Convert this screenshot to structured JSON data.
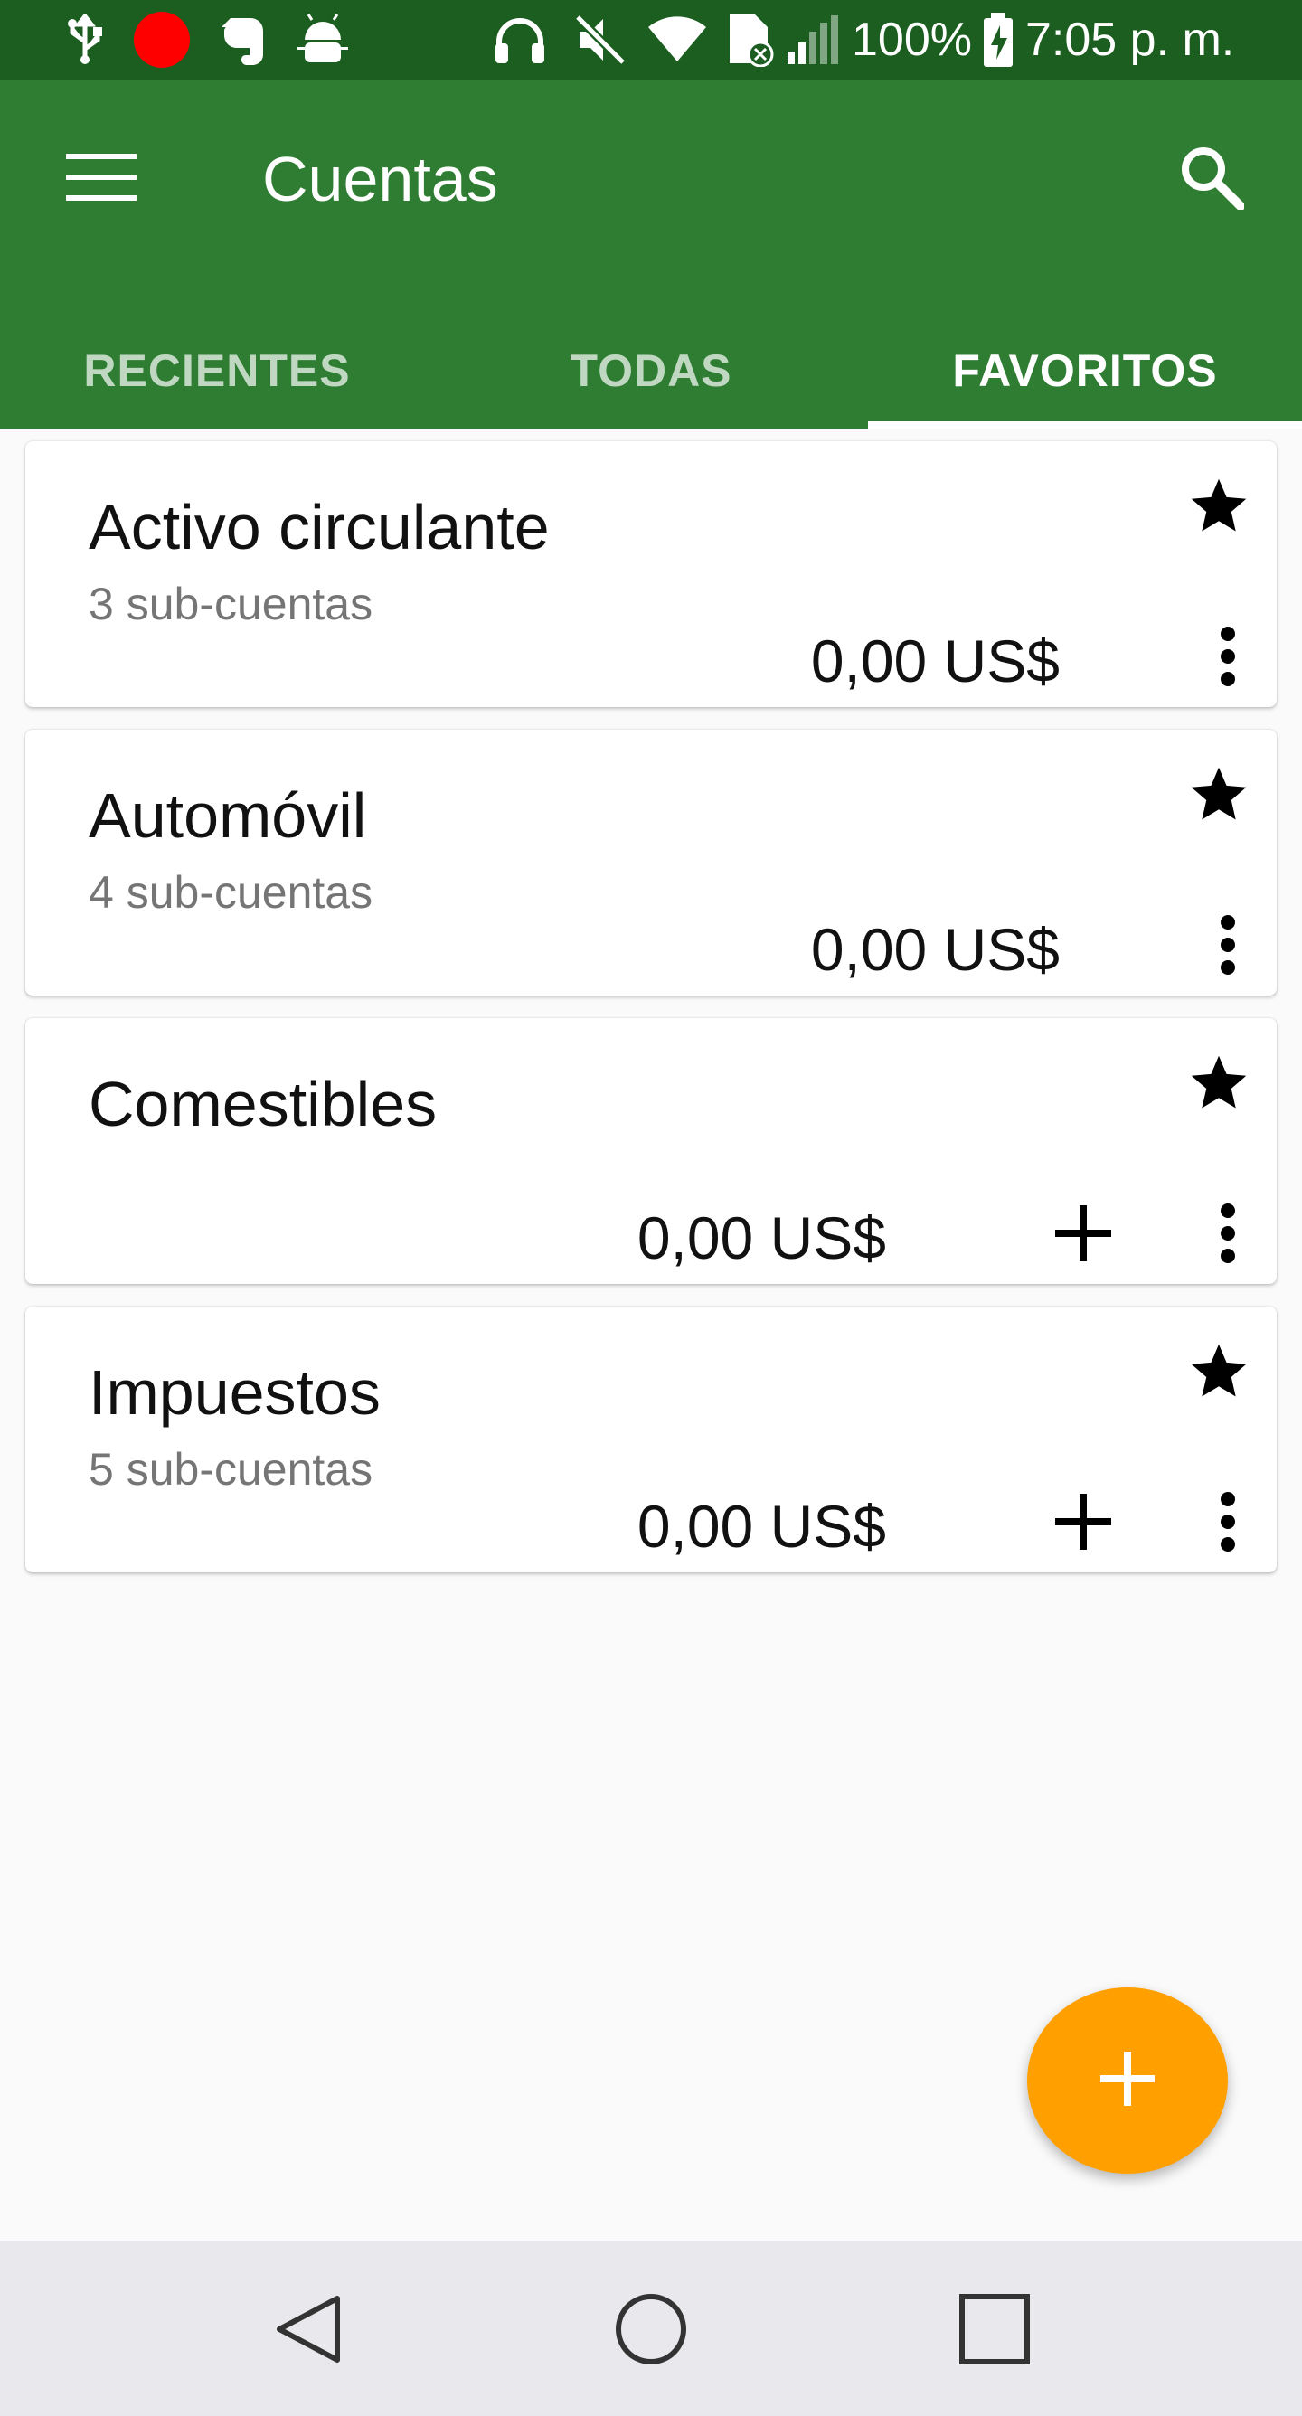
{
  "status_bar": {
    "icons": [
      "usb-icon",
      "record-icon",
      "evernote-icon",
      "android-debug-icon",
      "headphones-icon",
      "mute-icon",
      "wifi-icon",
      "sim-error-icon",
      "signal-icon",
      "battery-charging-icon"
    ],
    "battery": "100%",
    "time": "7:05 p. m."
  },
  "app_bar": {
    "title": "Cuentas",
    "menu_icon": "hamburger-menu-icon",
    "search_icon": "search-icon"
  },
  "tabs": [
    {
      "label": "RECIENTES",
      "active": false
    },
    {
      "label": "TODAS",
      "active": false
    },
    {
      "label": "FAVORITOS",
      "active": true
    }
  ],
  "accounts": [
    {
      "name": "Activo circulante",
      "subaccounts": "3 sub-cuentas",
      "balance": "0,00 US$",
      "favorite": true,
      "has_add": false
    },
    {
      "name": "Automóvil",
      "subaccounts": "4 sub-cuentas",
      "balance": "0,00 US$",
      "favorite": true,
      "has_add": false
    },
    {
      "name": "Comestibles",
      "subaccounts": "",
      "balance": "0,00 US$",
      "favorite": true,
      "has_add": true
    },
    {
      "name": "Impuestos",
      "subaccounts": "5 sub-cuentas",
      "balance": "0,00 US$",
      "favorite": true,
      "has_add": true
    }
  ],
  "fab": {
    "icon": "plus-icon"
  },
  "colors": {
    "status_bar": "#1b5e20",
    "app_bar": "#2e7d32",
    "fab": "#ffa000",
    "background": "#fafafa"
  }
}
